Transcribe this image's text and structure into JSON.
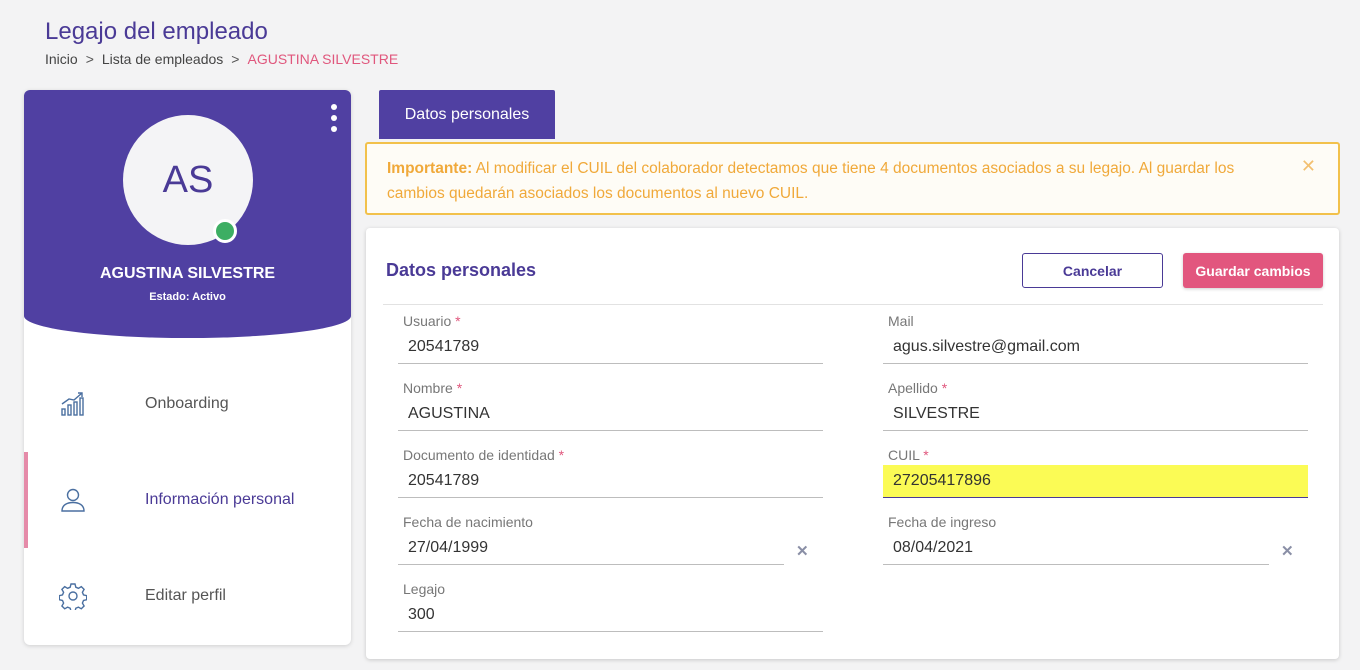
{
  "page": {
    "title": "Legajo del empleado"
  },
  "breadcrumb": {
    "items": [
      "Inicio",
      "Lista de empleados"
    ],
    "separator": ">",
    "current": "AGUSTINA SILVESTRE"
  },
  "profile": {
    "initials": "AS",
    "name": "AGUSTINA SILVESTRE",
    "status": "Estado: Activo",
    "status_color": "#3dae63",
    "header_color": "#5040a2"
  },
  "sidebar": {
    "items": [
      {
        "label": "Onboarding",
        "icon": "chart-growth-icon",
        "active": false
      },
      {
        "label": "Información personal",
        "icon": "user-icon",
        "active": true
      },
      {
        "label": "Editar perfil",
        "icon": "gear-icon",
        "active": false
      }
    ]
  },
  "tabs": [
    {
      "label": "Datos personales",
      "active": true
    }
  ],
  "alert": {
    "strong": "Importante:",
    "message": " Al modificar el CUIL del colaborador detectamos que tiene 4 documentos asociados a su legajo. Al guardar los cambios quedarán asociados los documentos al nuevo CUIL.",
    "close": "✕",
    "color": "#f0a93a"
  },
  "form": {
    "title": "Datos personales",
    "cancel_label": "Cancelar",
    "save_label": "Guardar cambios",
    "clear_symbol": "✕",
    "fields": {
      "usuario": {
        "label": "Usuario",
        "required": "*",
        "value": "20541789"
      },
      "mail": {
        "label": "Mail",
        "value": "agus.silvestre@gmail.com"
      },
      "nombre": {
        "label": "Nombre",
        "required": "*",
        "value": "AGUSTINA"
      },
      "apellido": {
        "label": "Apellido",
        "required": "*",
        "value": "SILVESTRE"
      },
      "documento": {
        "label": "Documento de identidad",
        "required": "*",
        "value": "20541789"
      },
      "cuil": {
        "label": "CUIL",
        "required": "*",
        "value": "27205417896"
      },
      "nacimiento": {
        "label": "Fecha de nacimiento",
        "value": "27/04/1999"
      },
      "ingreso": {
        "label": "Fecha de ingreso",
        "value": "08/04/2021"
      },
      "legajo": {
        "label": "Legajo",
        "value": "300"
      }
    }
  }
}
